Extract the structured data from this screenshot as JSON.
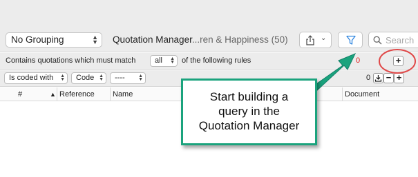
{
  "toolbar": {
    "grouping_value": "No Grouping",
    "title_main": "Quotation Manager",
    "title_rest": "...ren & Happiness (50)",
    "search_placeholder": "Search"
  },
  "rules_bar": {
    "prefix": "Contains quotations which must match",
    "match_value": "all",
    "suffix": "of the following rules",
    "count": "0"
  },
  "condition": {
    "field": "Is coded with",
    "type": "Code",
    "value": "----",
    "count": "0"
  },
  "columns": [
    "#",
    "Reference",
    "Name",
    "Document"
  ],
  "callout_text": [
    "Start building a",
    "query in the",
    "Quotation Manager"
  ],
  "colors": {
    "callout_border": "#1aa37d",
    "arrow": "#1aa37d",
    "highlight_ring": "#e04848",
    "count_red": "#e02020",
    "filter_icon": "#2f86e0"
  },
  "icons": [
    "share-icon",
    "filter-icon",
    "search-icon",
    "sort-ascending-icon",
    "import-icon"
  ]
}
